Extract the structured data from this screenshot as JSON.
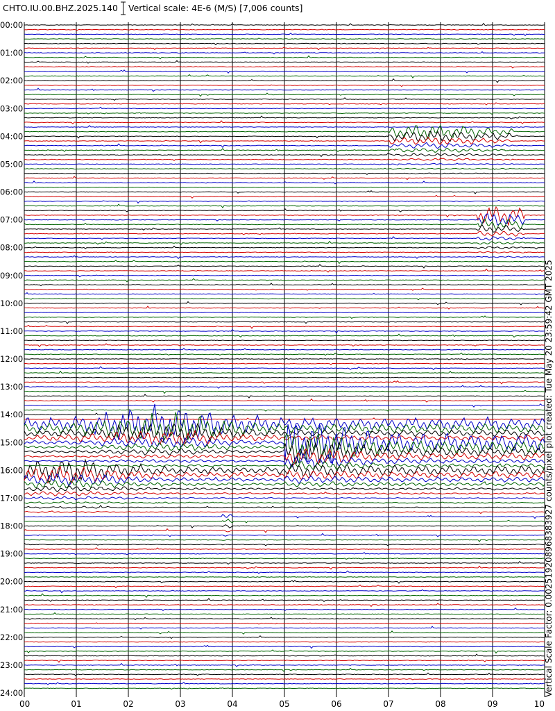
{
  "header": {
    "station": "CHTO.IU.00.BHZ.2025.140",
    "scale_label": "Vertical scale: 4E-6 (M/S) [7,006 counts]"
  },
  "side_label": "Vertical Scale Factor: 0.002519208968383927 counts/pixel plot created: Tue May 20 23:59:42 GMT 2025",
  "colors": {
    "trace_cycle": [
      "#000000",
      "#d40000",
      "#0000c8",
      "#006400"
    ],
    "grid": "#000000",
    "background": "#ffffff"
  },
  "chart_data": {
    "type": "line",
    "title": "",
    "subtitle": "",
    "xlabel": "",
    "ylabel": "",
    "x_unit_note": "",
    "x_ticks": [
      "00",
      "01",
      "02",
      "03",
      "04",
      "05",
      "06",
      "07",
      "08",
      "09",
      "10"
    ],
    "xlim": [
      0,
      10
    ],
    "y_ticks": [
      "00:00",
      "01:00",
      "02:00",
      "03:00",
      "04:00",
      "05:00",
      "06:00",
      "07:00",
      "08:00",
      "09:00",
      "10:00",
      "11:00",
      "12:00",
      "13:00",
      "14:00",
      "15:00",
      "16:00",
      "17:00",
      "18:00",
      "19:00",
      "20:00",
      "21:00",
      "22:00",
      "23:00",
      "24:00"
    ],
    "ylim": [
      "00:00",
      "24:00"
    ],
    "traces_per_hour": 6,
    "trace_minutes": 10,
    "grid": true,
    "series": [
      {
        "events": [
          {
            "start": "03:50",
            "x_start": 7.0,
            "x_end": 9.4,
            "peak_x": 7.8,
            "amplitude": 12
          },
          {
            "start": "06:50",
            "x_start": 8.7,
            "x_end": 9.6,
            "peak_x": 8.8,
            "amplitude": 16
          },
          {
            "start": "14:20",
            "x_start": 0.0,
            "x_end": 10.0,
            "peak_x": 2.7,
            "amplitude": 32
          },
          {
            "start": "15:00",
            "x_start": 5.0,
            "x_end": 10.0,
            "peak_x": 5.3,
            "amplitude": 35
          },
          {
            "start": "16:00",
            "x_start": 0.0,
            "x_end": 10.0,
            "peak_x": 0.8,
            "amplitude": 18
          },
          {
            "start": "17:40",
            "x_start": 3.8,
            "x_end": 4.0,
            "peak_x": 3.9,
            "amplitude": 5
          }
        ]
      }
    ]
  }
}
